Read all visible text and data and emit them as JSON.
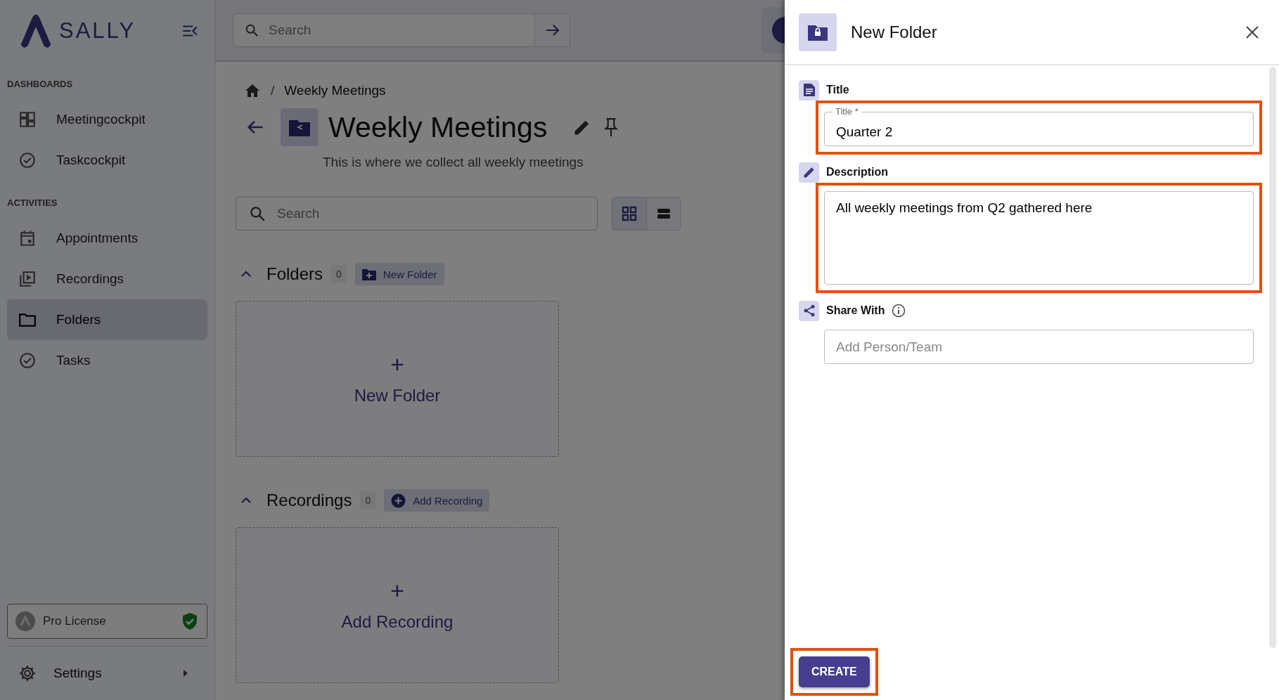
{
  "brand": {
    "name": "SALLY"
  },
  "sidebar": {
    "sections": [
      {
        "heading": "DASHBOARDS",
        "items": [
          {
            "label": "Meetingcockpit",
            "selected": false
          },
          {
            "label": "Taskcockpit",
            "selected": false
          }
        ]
      },
      {
        "heading": "ACTIVITIES",
        "items": [
          {
            "label": "Appointments",
            "selected": false
          },
          {
            "label": "Recordings",
            "selected": false
          },
          {
            "label": "Folders",
            "selected": true
          },
          {
            "label": "Tasks",
            "selected": false
          }
        ]
      }
    ],
    "license": {
      "label": "Pro License",
      "verified": true
    },
    "settings": {
      "label": "Settings"
    }
  },
  "topbar": {
    "search": {
      "placeholder": "Search"
    }
  },
  "breadcrumb": [
    {
      "separator": "/",
      "label": "Weekly Meetings"
    }
  ],
  "folder": {
    "title": "Weekly Meetings",
    "description": "This is where we collect all weekly meetings"
  },
  "content_search": {
    "placeholder": "Search"
  },
  "view_modes": [
    {
      "selected": true
    },
    {
      "selected": false
    }
  ],
  "sections": [
    {
      "title": "Folders",
      "count": "0",
      "expanded": true,
      "action": "New Folder",
      "empty_card": {
        "symbol": "+",
        "label": "New Folder"
      }
    },
    {
      "title": "Recordings",
      "count": "0",
      "expanded": true,
      "action": "Add Recording",
      "empty_card": {
        "symbol": "+",
        "label": "Add Recording"
      }
    }
  ],
  "drawer": {
    "title": "New Folder",
    "fields": [
      {
        "kind": "text",
        "heading": "Title",
        "label": "Title *",
        "value": "Quarter 2",
        "highlighted": true
      },
      {
        "kind": "textarea",
        "heading": "Description",
        "value": "All weekly meetings from Q2 gathered here",
        "highlighted": true
      },
      {
        "kind": "people",
        "heading": "Share With",
        "info": true,
        "placeholder": "Add Person/Team",
        "highlighted": false
      }
    ],
    "submit": {
      "label": "CREATE",
      "highlighted": true
    }
  }
}
